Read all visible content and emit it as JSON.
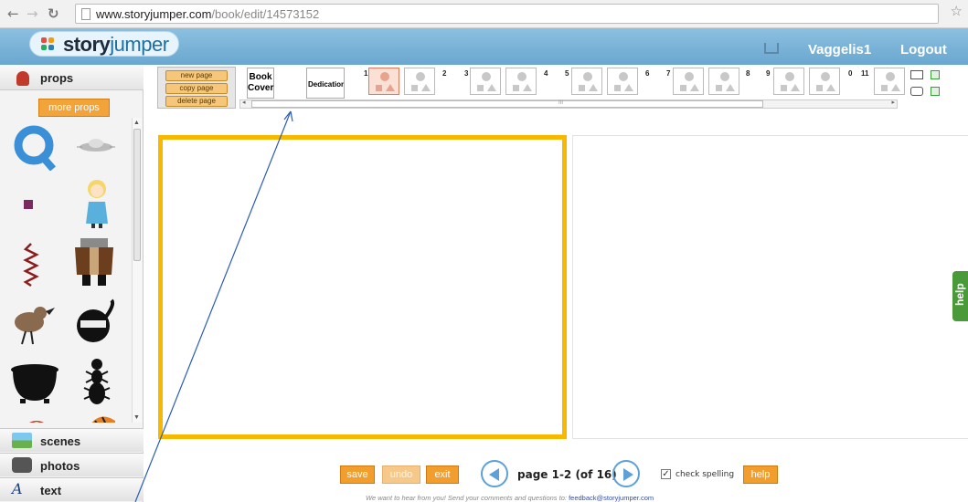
{
  "browser": {
    "url_host": "www.storyjumper.com",
    "url_path": "/book/edit/14573152",
    "back_icon": "arrow-left",
    "forward_icon": "arrow-right",
    "reload_icon": "reload",
    "bookmark_icon": "star"
  },
  "header": {
    "logo_story": "story",
    "logo_jumper": "jumper",
    "username": "Vaggelis1",
    "logout": "Logout",
    "cart_icon": "cart"
  },
  "sidebar": {
    "props_label": "props",
    "more_props": "more props",
    "sections": [
      {
        "label": "scenes",
        "icon": "scenes-icon",
        "color": "#6ab04c"
      },
      {
        "label": "photos",
        "icon": "camera-icon",
        "color": "#555555"
      },
      {
        "label": "text",
        "icon": "text-icon",
        "color": "#1a3f7a"
      }
    ],
    "text_glyph": "A"
  },
  "toolbar": {
    "new_page": "new page",
    "copy_page": "copy page",
    "delete_page": "delete page",
    "book_cover": "Book Cover",
    "dedication": "Dedication",
    "page_numbers": [
      "1",
      "2",
      "3",
      "4",
      "5",
      "6",
      "7",
      "8",
      "9",
      "0",
      "11"
    ],
    "scroll_grip": "III"
  },
  "editor": {
    "help_tab": "help"
  },
  "bottom": {
    "save": "save",
    "undo": "undo",
    "exit": "exit",
    "page_info": "page 1-2 (of 16)",
    "check_spelling": "check spelling",
    "check_mark": "✓",
    "help": "help",
    "feedback_text": "We want to hear from you! Send your comments and questions to:",
    "feedback_email": "feedback@storyjumper.com"
  },
  "colors": {
    "accent_orange": "#f29e2e",
    "page_border": "#f7b900",
    "header_blue": "#6aa7cf",
    "help_green": "#4a9a3a"
  }
}
